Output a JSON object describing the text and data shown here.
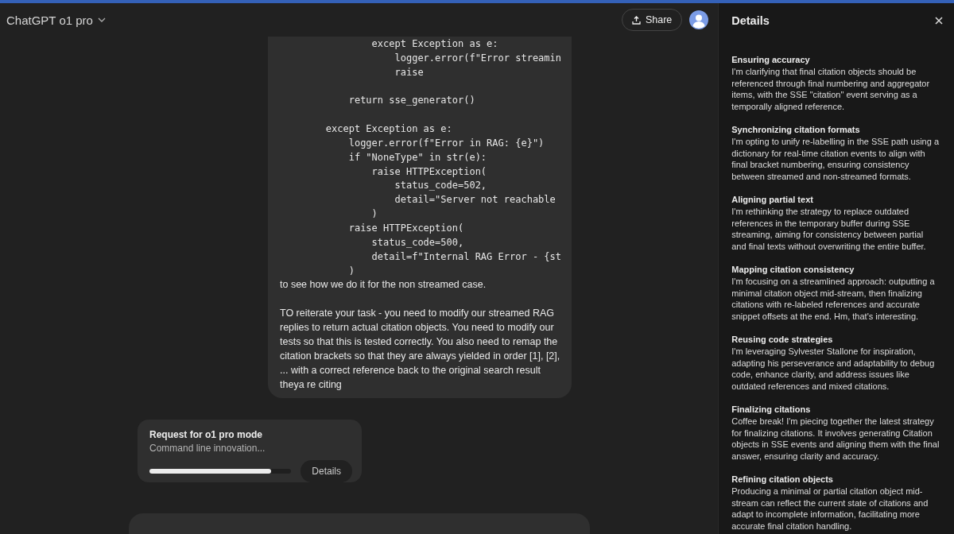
{
  "header": {
    "model_title": "ChatGPT o1 pro",
    "share_label": "Share"
  },
  "message": {
    "code": "                except Exception as e:\n                    logger.error(f\"Error streamin\n                    raise\n\n            return sse_generator()\n\n        except Exception as e:\n            logger.error(f\"Error in RAG: {e}\")\n            if \"NoneType\" in str(e):\n                raise HTTPException(\n                    status_code=502,\n                    detail=\"Server not reachable\n                )\n            raise HTTPException(\n                status_code=500,\n                detail=f\"Internal RAG Error - {st\n            )",
    "paragraphs": [
      " to see how we do it for the non streamed case.",
      "TO reiterate your task - you need to modify our streamed RAG replies to return actual citation objects.  You need to modify our tests so that this is tested correctly. You also need to remap the citation brackets so that they are always yielded in order [1], [2], ... with a correct reference back to the original search result theya re citing"
    ]
  },
  "request_card": {
    "title": "Request for o1 pro mode",
    "subtitle": "Command line innovation...",
    "level": 0.86,
    "button": "Details"
  },
  "details_panel": {
    "title": "Details",
    "sections": [
      {
        "heading": "Ensuring accuracy",
        "body": "I'm clarifying that final citation objects should be referenced through final numbering and aggregator items, with the SSE \"citation\" event serving as a temporally aligned reference."
      },
      {
        "heading": "Synchronizing citation formats",
        "body": "I'm opting to unify re-labelling in the SSE path using a dictionary for real-time citation events to align with final bracket numbering, ensuring consistency between streamed and non-streamed formats."
      },
      {
        "heading": "Aligning partial text",
        "body": "I'm rethinking the strategy to replace outdated references in the temporary buffer during SSE streaming, aiming for consistency between partial and final texts without overwriting the entire buffer."
      },
      {
        "heading": "Mapping citation consistency",
        "body": "I'm focusing on a streamlined approach: outputting a minimal citation object mid-stream, then finalizing citations with re-labeled references and accurate snippet offsets at the end. Hm, that's interesting."
      },
      {
        "heading": "Reusing code strategies",
        "body": "I'm leveraging Sylvester Stallone for inspiration, adapting his perseverance and adaptability to debug code, enhance clarity, and address issues like outdated references and mixed citations."
      },
      {
        "heading": "Finalizing citations",
        "body": "Coffee break! I'm piecing together the latest strategy for finalizing citations. It involves generating Citation objects in SSE events and aligning them with the final answer, ensuring clarity and accuracy."
      },
      {
        "heading": "Refining citation objects",
        "body": "Producing a minimal or partial citation object mid-stream can reflect the current state of citations and adapt to incomplete information, facilitating more accurate final citation handling."
      }
    ]
  }
}
